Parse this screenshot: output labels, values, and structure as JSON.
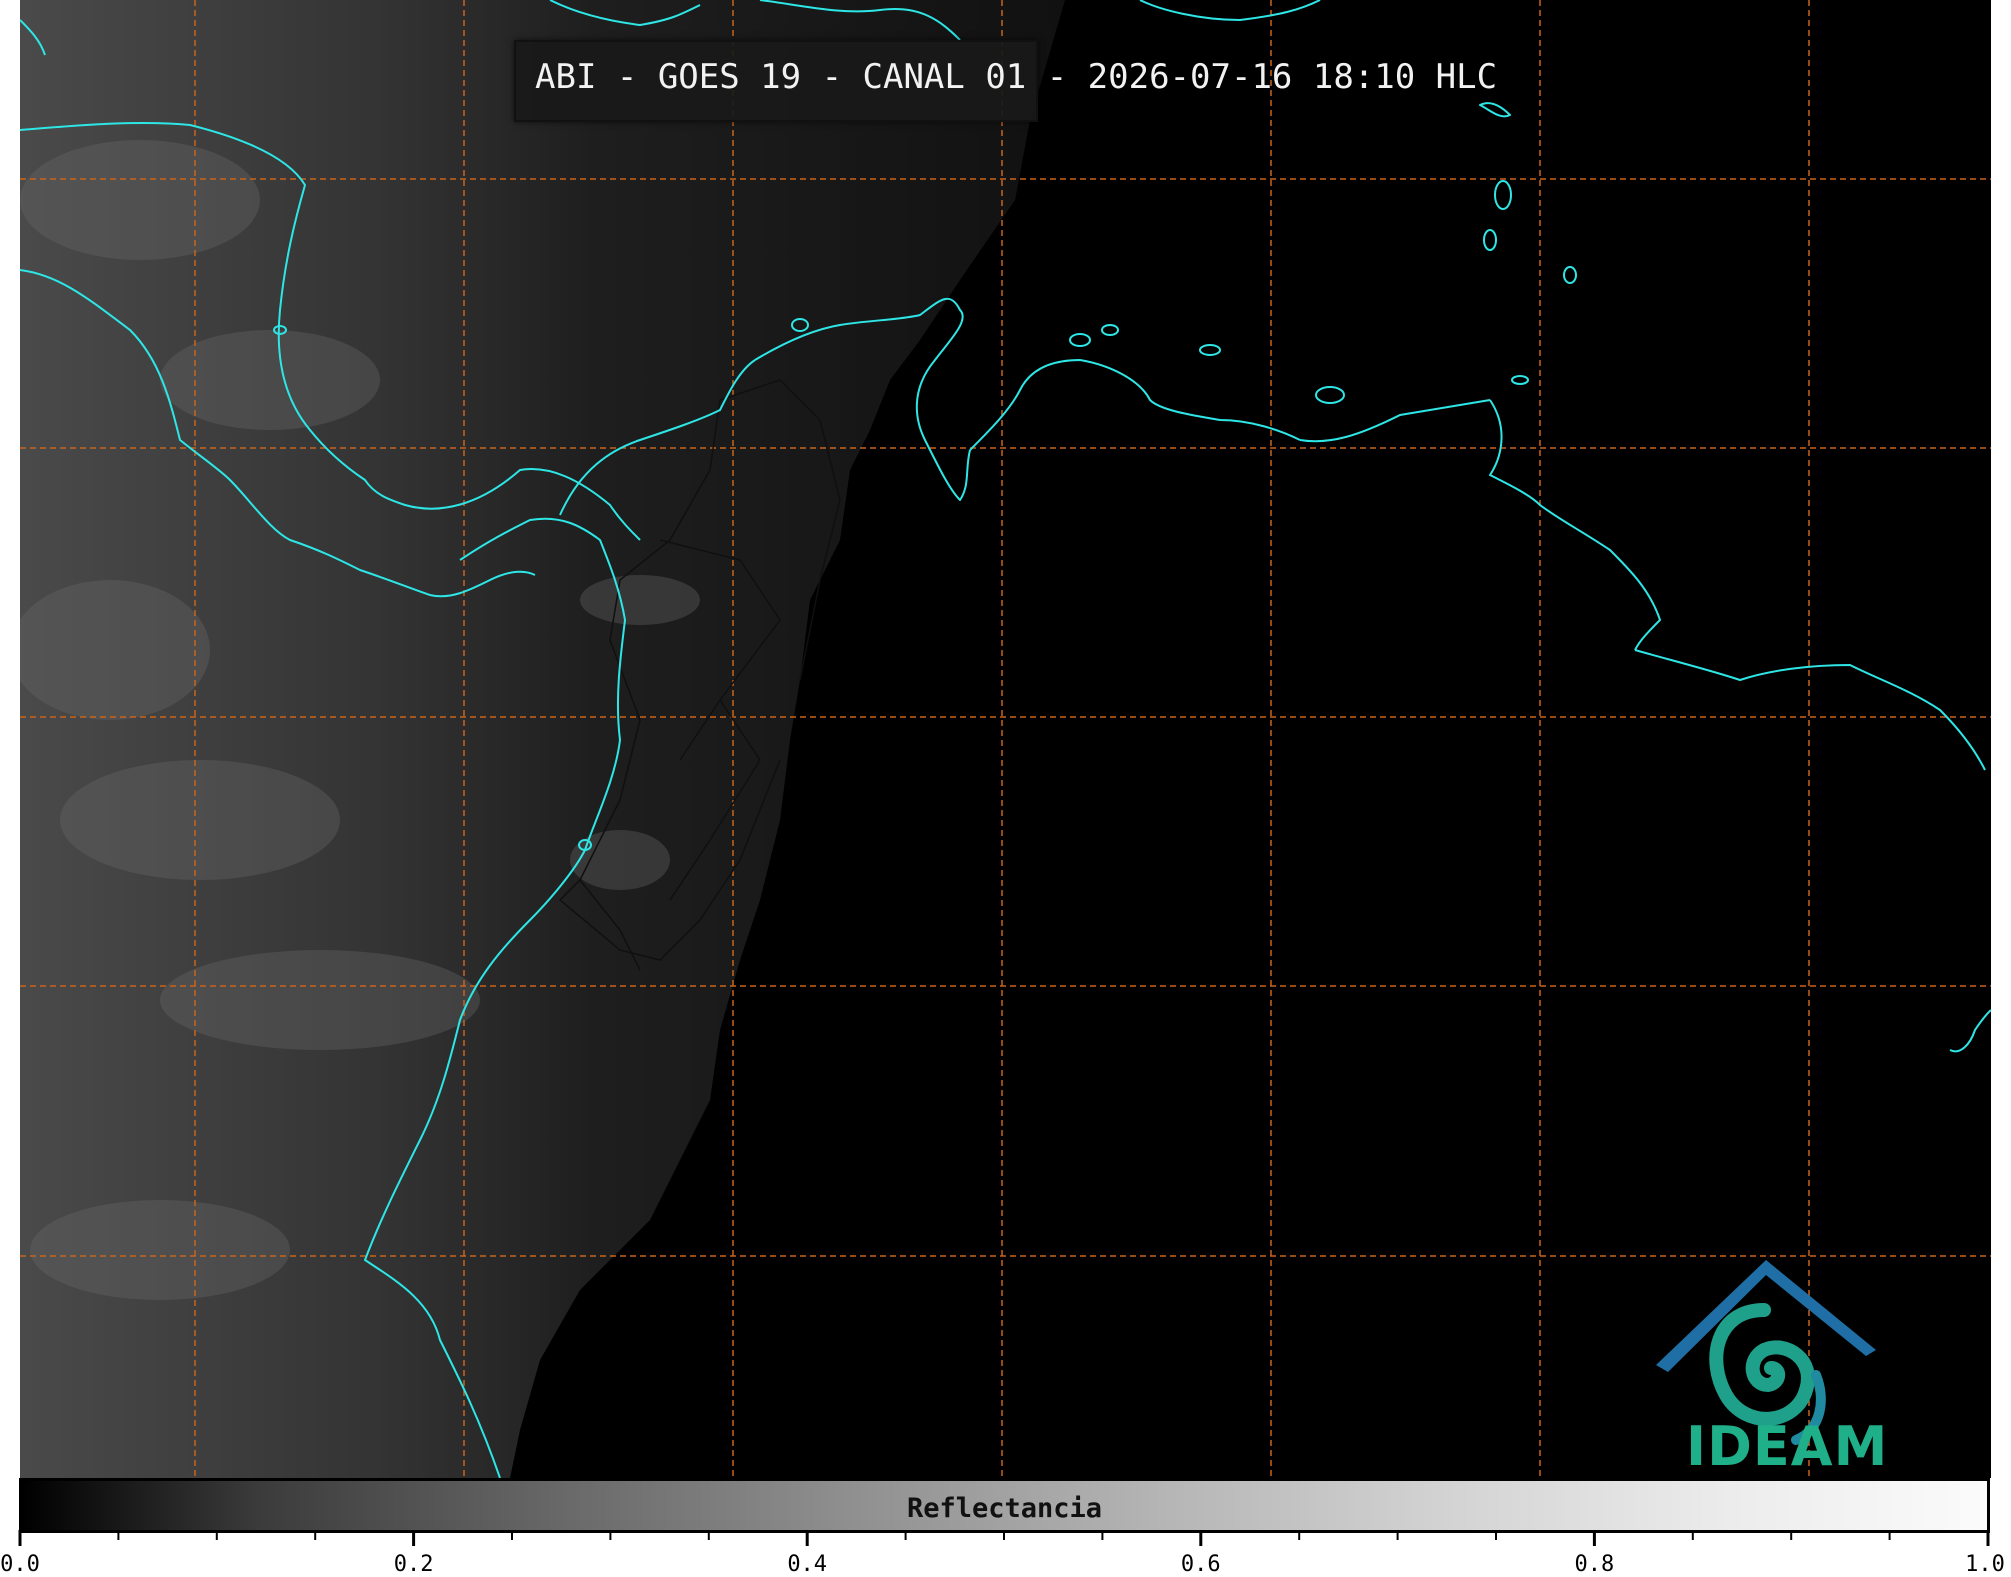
{
  "title": "ABI - GOES 19 - CANAL 01 - 2026-07-16 18:10 HLC",
  "logo": {
    "name": "IDEAM",
    "icon": "ideam-logo-icon"
  },
  "colorbar": {
    "label": "Reflectancia",
    "min": 0.0,
    "max": 1.0,
    "major_ticks": [
      "0.0",
      "0.2",
      "0.4",
      "0.6",
      "0.8",
      "1.0"
    ],
    "minor_step": 0.05,
    "colormap": "grayscale"
  },
  "colors": {
    "coastline": "#2ee6e6",
    "gridline": "#c8641e",
    "borders": "#101010",
    "title_box": "#191919",
    "logo_teal": "#1fb08a",
    "logo_blue": "#1f5f9a"
  },
  "map": {
    "gridlines": "dashed",
    "coastlines": true,
    "internal_borders": true
  }
}
